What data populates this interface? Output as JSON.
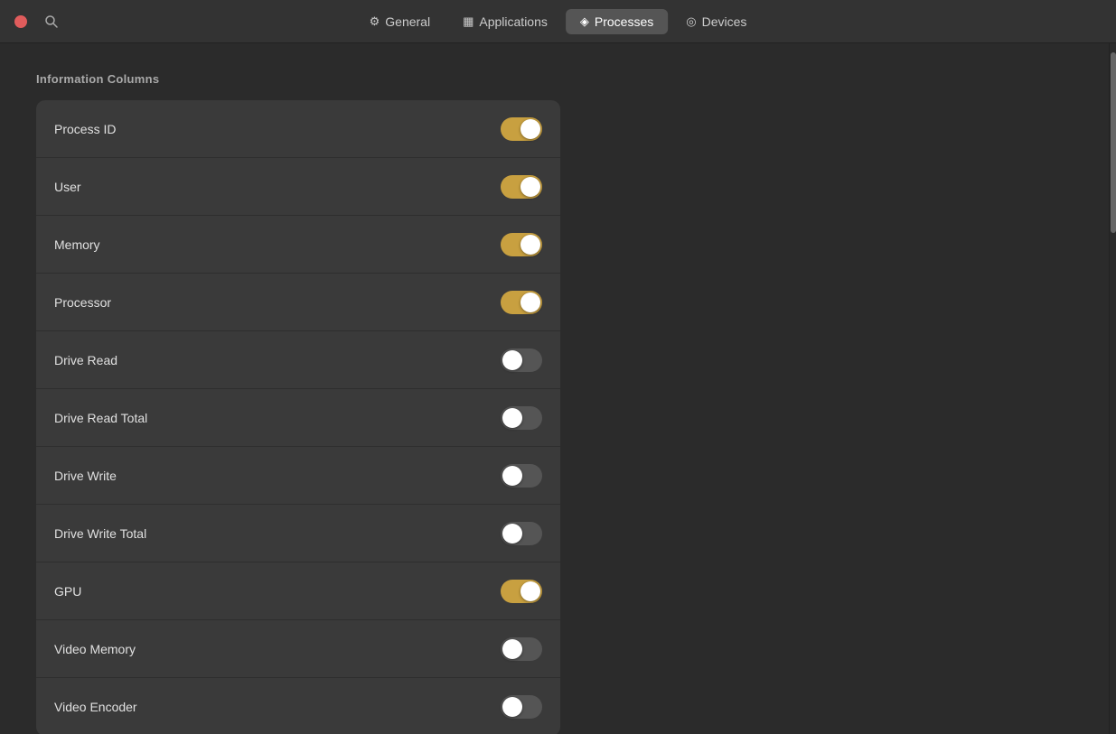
{
  "titlebar": {
    "tabs": [
      {
        "id": "general",
        "label": "General",
        "icon": "⚙",
        "active": false
      },
      {
        "id": "applications",
        "label": "Applications",
        "icon": "▦",
        "active": false
      },
      {
        "id": "processes",
        "label": "Processes",
        "icon": "◈",
        "active": true
      },
      {
        "id": "devices",
        "label": "Devices",
        "icon": "◎",
        "active": false
      }
    ]
  },
  "main": {
    "section_title": "Information Columns",
    "rows": [
      {
        "id": "process-id",
        "label": "Process ID",
        "enabled": true
      },
      {
        "id": "user",
        "label": "User",
        "enabled": true
      },
      {
        "id": "memory",
        "label": "Memory",
        "enabled": true
      },
      {
        "id": "processor",
        "label": "Processor",
        "enabled": true
      },
      {
        "id": "drive-read",
        "label": "Drive Read",
        "enabled": false
      },
      {
        "id": "drive-read-total",
        "label": "Drive Read Total",
        "enabled": false
      },
      {
        "id": "drive-write",
        "label": "Drive Write",
        "enabled": false
      },
      {
        "id": "drive-write-total",
        "label": "Drive Write Total",
        "enabled": false
      },
      {
        "id": "gpu",
        "label": "GPU",
        "enabled": true
      },
      {
        "id": "video-memory",
        "label": "Video Memory",
        "enabled": false
      },
      {
        "id": "video-encoder",
        "label": "Video Encoder",
        "enabled": false
      }
    ]
  }
}
